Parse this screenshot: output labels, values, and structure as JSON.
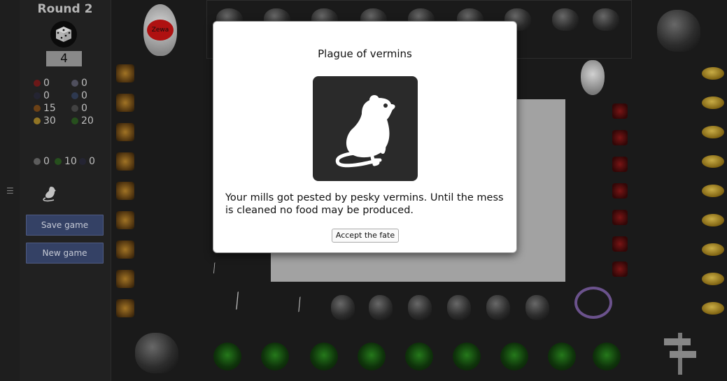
{
  "sidebar": {
    "round_label": "Round 2",
    "dice_value": "4",
    "resources": [
      {
        "icon": "red-gem-icon",
        "value": "0"
      },
      {
        "icon": "crystal-icon",
        "value": "0"
      },
      {
        "icon": "dark-ore-icon",
        "value": "0"
      },
      {
        "icon": "blue-stone-icon",
        "value": "0"
      },
      {
        "icon": "wood-icon",
        "value": "15"
      },
      {
        "icon": "iron-icon",
        "value": "0"
      },
      {
        "icon": "food-icon",
        "value": "30"
      },
      {
        "icon": "herb-icon",
        "value": "20"
      }
    ],
    "units": [
      {
        "icon": "worker-icon",
        "value": "0"
      },
      {
        "icon": "soldier-icon",
        "value": "10"
      },
      {
        "icon": "shadow-icon",
        "value": "0"
      }
    ],
    "save_label": "Save game",
    "new_label": "New game"
  },
  "board": {
    "player_token": "Zewa"
  },
  "modal": {
    "title": "Plague of vermins",
    "message": "Your mills got pested by pesky vermins. Until the mess is cleaned no food may be produced.",
    "button_label": "Accept the fate"
  }
}
